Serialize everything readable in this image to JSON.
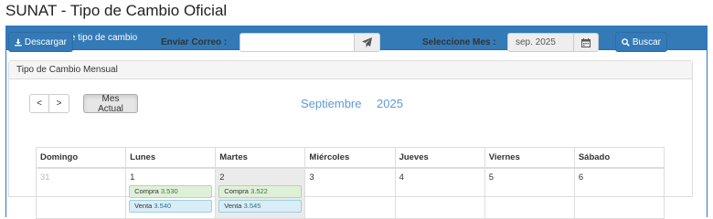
{
  "page": {
    "title": "SUNAT - Tipo de Cambio Oficial"
  },
  "panel": {
    "heading": "Consulta de tipo de cambio"
  },
  "toolbar": {
    "download_label": "Descargar",
    "email_label": "Enviar Correo :",
    "email_value": "",
    "month_label": "Seleccione Mes :",
    "month_value": "sep. 2025",
    "search_label": "Buscar"
  },
  "monthly": {
    "heading": "Tipo de Cambio Mensual",
    "prev_label": "<",
    "next_label": ">",
    "current_label": "Mes Actual",
    "month_name": "Septiembre",
    "year": "2025"
  },
  "calendar": {
    "headers": [
      "Domingo",
      "Lunes",
      "Martes",
      "Miércoles",
      "Jueves",
      "Viernes",
      "Sábado"
    ],
    "days": [
      "31",
      "1",
      "2",
      "3",
      "4",
      "5",
      "6"
    ],
    "buy_label": "Compra",
    "sell_label": "Venta",
    "rates": {
      "mon": {
        "buy": "3.530",
        "sell": "3.540"
      },
      "tue": {
        "buy": "3.522",
        "sell": "3.545"
      }
    }
  },
  "colors": {
    "primary": "#337ab7",
    "buy_bg": "#dff0d8",
    "sell_bg": "#d9edf7",
    "month_title": "#5b9bd5"
  }
}
